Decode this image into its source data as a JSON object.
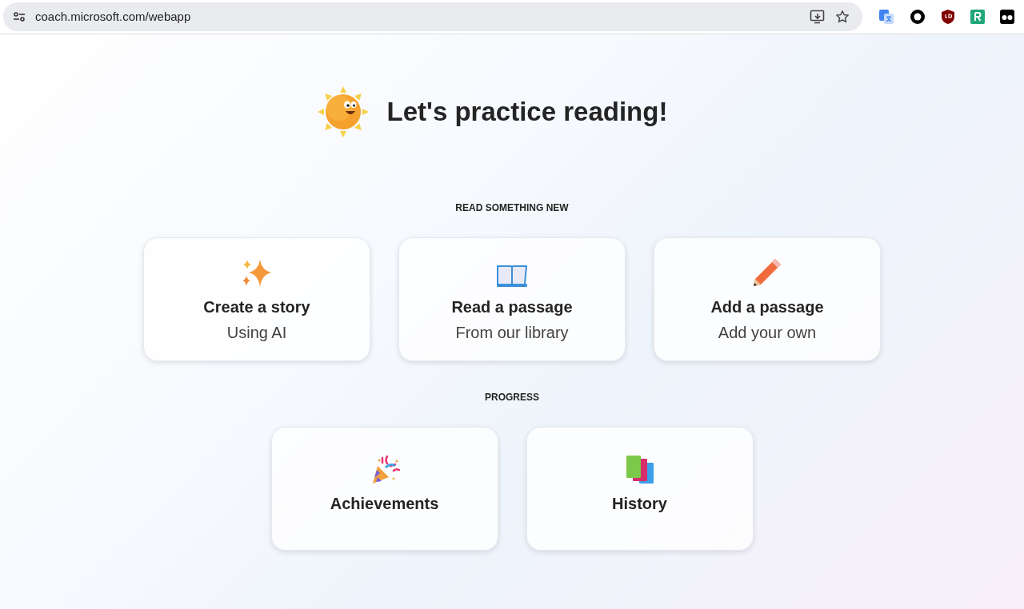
{
  "browser": {
    "address": "coach.microsoft.com/webapp"
  },
  "heading": "Let's practice reading!",
  "sections": [
    {
      "label": "READ SOMETHING NEW",
      "cards": [
        {
          "title": "Create a story",
          "subtitle": "Using AI"
        },
        {
          "title": "Read a passage",
          "subtitle": "From our library"
        },
        {
          "title": "Add a passage",
          "subtitle": "Add your own"
        }
      ]
    },
    {
      "label": "PROGRESS",
      "cards": [
        {
          "title": "Achievements"
        },
        {
          "title": "History"
        }
      ]
    }
  ]
}
